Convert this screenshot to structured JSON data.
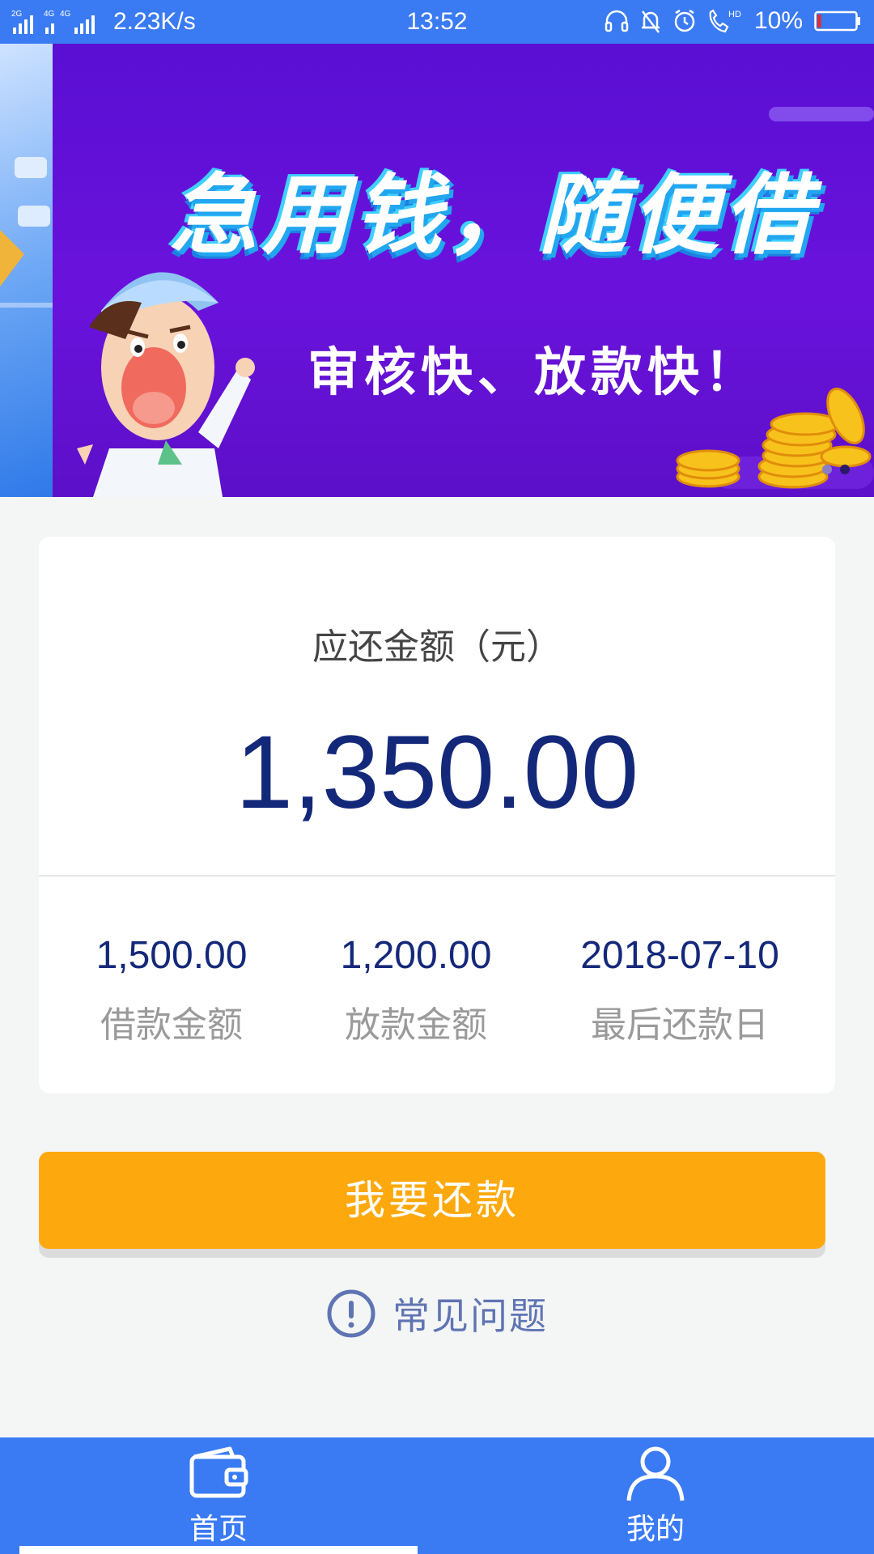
{
  "status_bar": {
    "signal_labels": [
      "2G",
      "4G",
      "4G"
    ],
    "speed": "2.23K/s",
    "time": "13:52",
    "icons": [
      "headphones-icon",
      "bell-muted-icon",
      "alarm-icon",
      "hd-call-icon",
      "battery-icon"
    ],
    "hd_label": "HD",
    "battery_percent": "10%",
    "battery_level": 0.1
  },
  "banner": {
    "headline": "急用钱，随便借",
    "subheadline": "审核快、放款快！",
    "page_count": 2,
    "active_page": 2,
    "colors": {
      "background": "#5a0fd3",
      "headline_outline": "#22a6ef",
      "coins": "#f7c21c"
    }
  },
  "repayment_card": {
    "amount_label": "应还金额（元）",
    "amount_due": "1,350.00",
    "stats": [
      {
        "value": "1,500.00",
        "label": "借款金额"
      },
      {
        "value": "1,200.00",
        "label": "放款金额"
      },
      {
        "value": "2018-07-10",
        "label": "最后还款日"
      }
    ]
  },
  "repay_button": {
    "label": "我要还款",
    "color": "#fda90d"
  },
  "faq": {
    "label": "常见问题",
    "icon": "exclamation-circle-icon"
  },
  "bottom_nav": {
    "items": [
      {
        "label": "首页",
        "icon": "wallet-icon",
        "active": true
      },
      {
        "label": "我的",
        "icon": "user-icon",
        "active": false
      }
    ],
    "color": "#3a7bf3"
  },
  "colors": {
    "accent_blue": "#3a7bf3",
    "amount_navy": "#14287a",
    "faq_text": "#5f74b3"
  }
}
